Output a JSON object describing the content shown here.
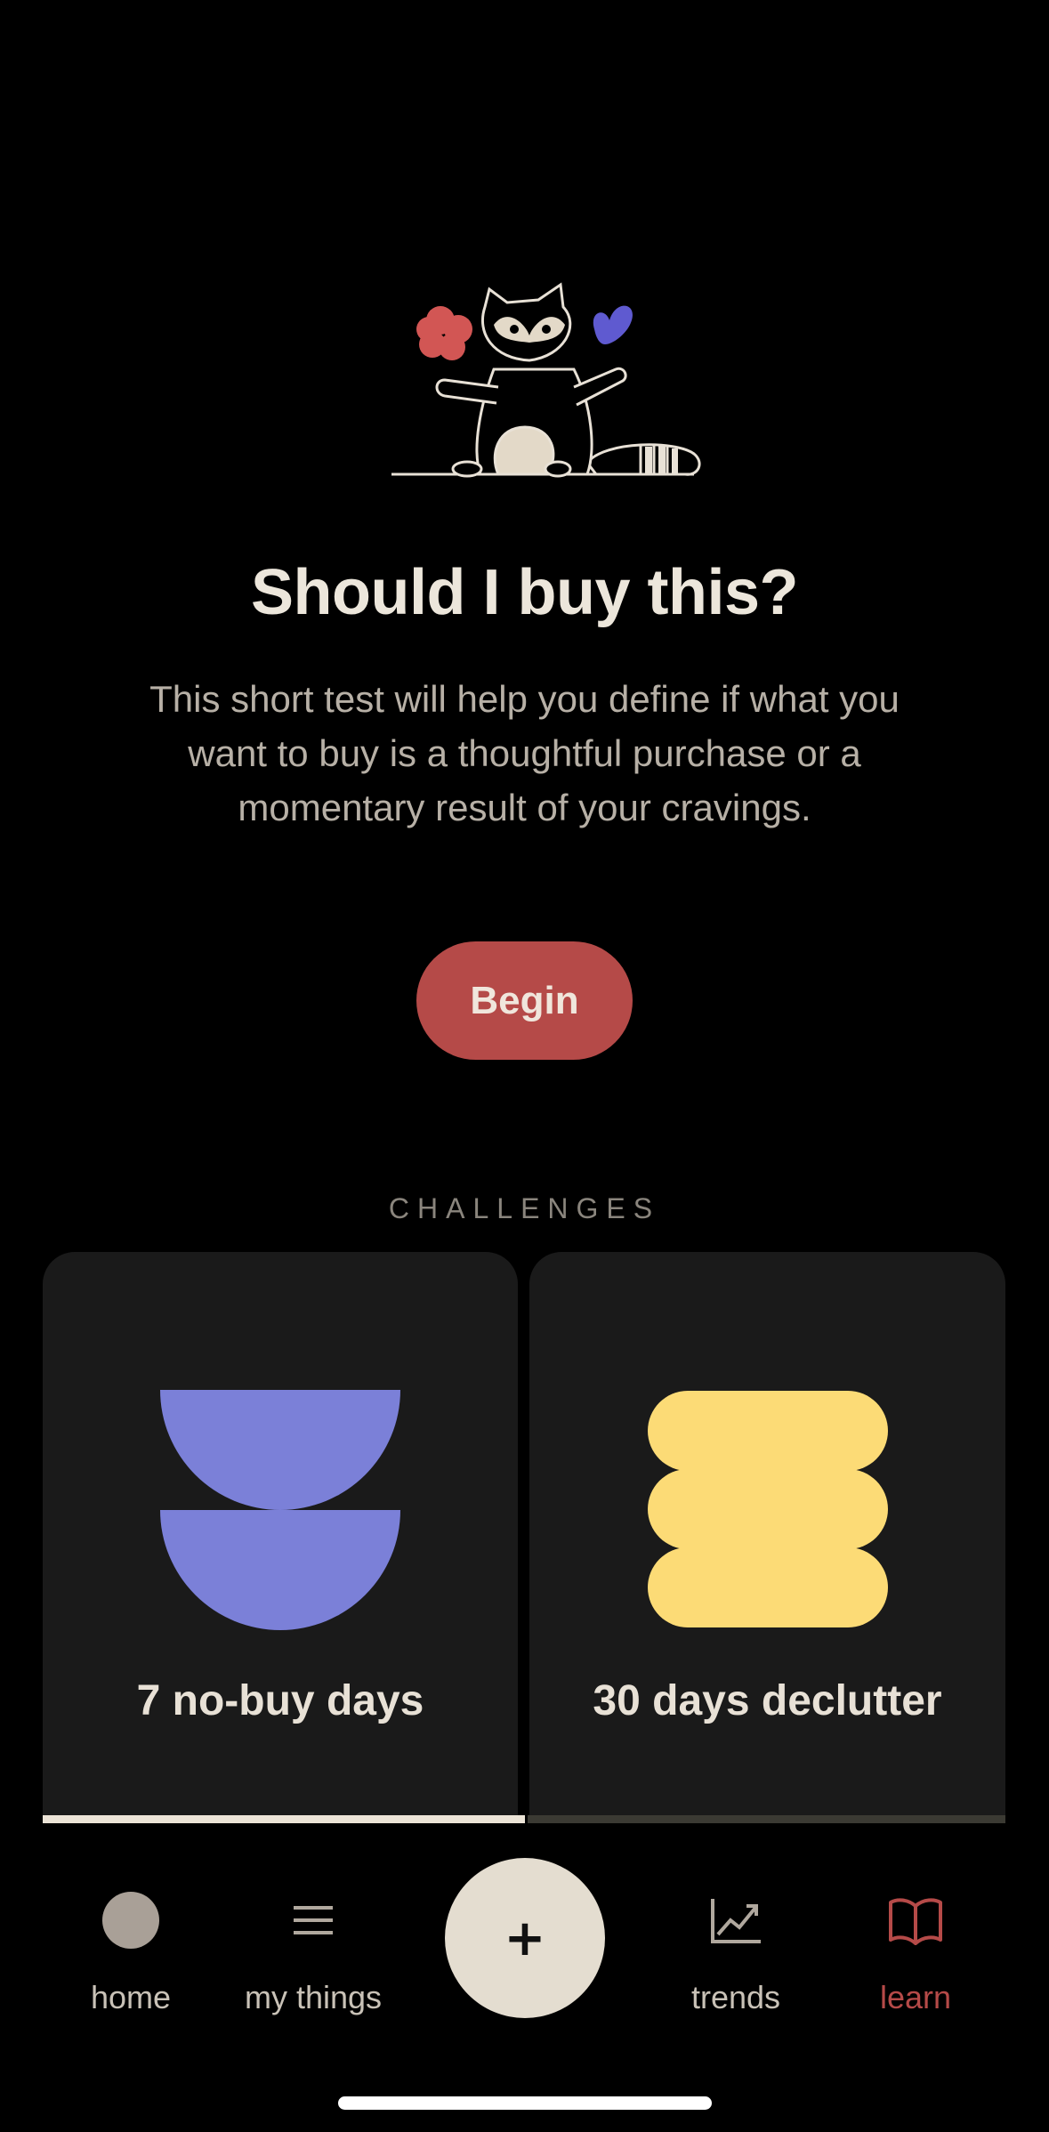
{
  "hero": {
    "title": "Should I buy this?",
    "description": "This short test will help you define if what you want to buy is a thoughtful purchase or a momentary result of your cravings.",
    "begin_label": "Begin",
    "illustration_icon": "raccoon-illustration"
  },
  "challenges": {
    "section_label": "CHALLENGES",
    "items": [
      {
        "label": "7 no-buy days",
        "icon": "half-circles-shape",
        "color": "#7b80d8",
        "progress": 1.0
      },
      {
        "label": "30 days declutter",
        "icon": "stacked-pills-shape",
        "color": "#fcdb76",
        "progress": 0.0
      }
    ]
  },
  "nav": {
    "items": [
      {
        "label": "home",
        "icon": "home-circle-icon"
      },
      {
        "label": "my things",
        "icon": "list-icon"
      },
      {
        "label": "+",
        "icon": "plus-icon"
      },
      {
        "label": "trends",
        "icon": "trends-chart-icon"
      },
      {
        "label": "learn",
        "icon": "book-icon",
        "active": true
      }
    ]
  },
  "colors": {
    "background": "#000000",
    "accent": "#b54a48",
    "card": "#1a1a1a",
    "text": "#e8e1d6"
  }
}
